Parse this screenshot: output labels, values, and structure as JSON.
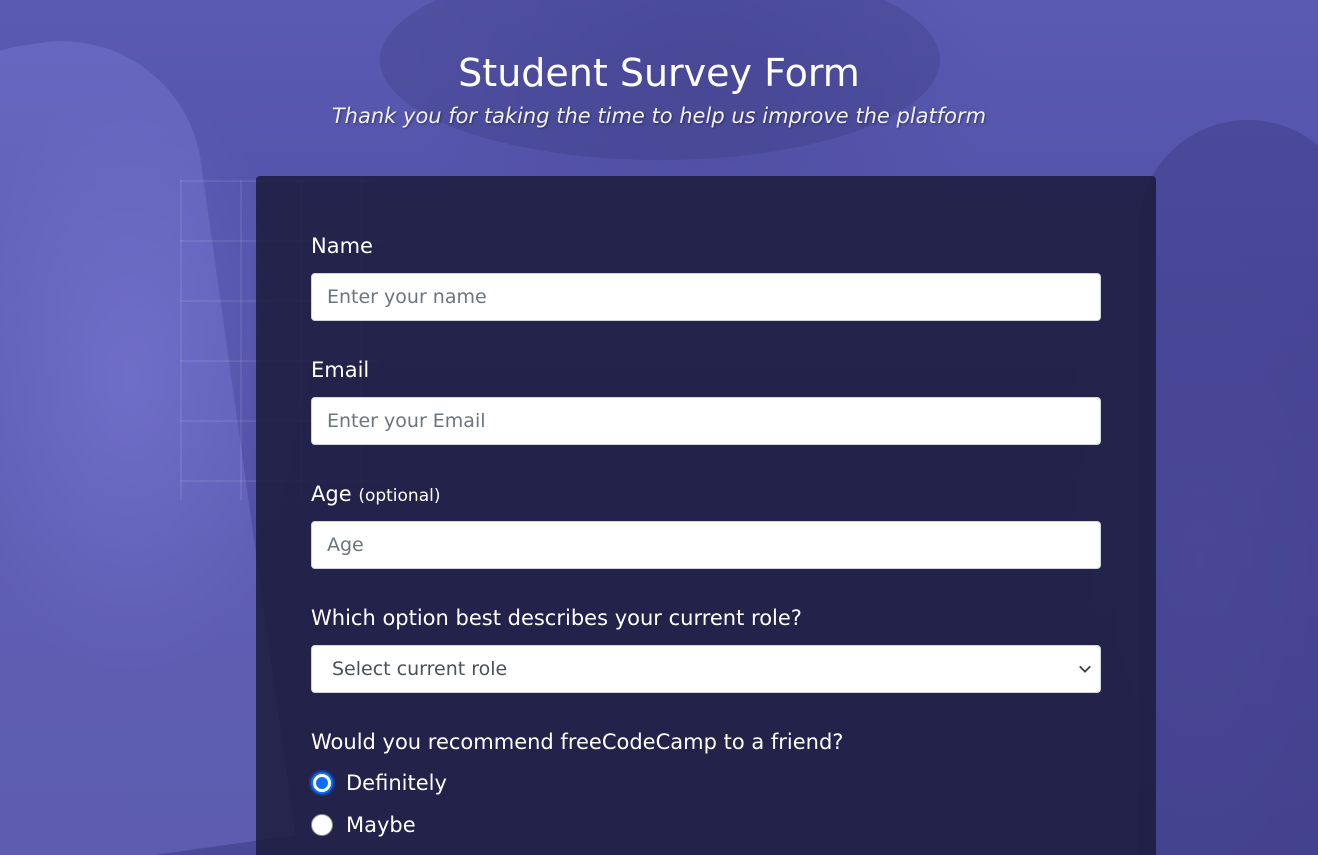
{
  "header": {
    "title": "Student Survey Form",
    "description": "Thank you for taking the time to help us improve the platform"
  },
  "form": {
    "name": {
      "label": "Name",
      "placeholder": "Enter your name",
      "value": ""
    },
    "email": {
      "label": "Email",
      "placeholder": "Enter your Email",
      "value": ""
    },
    "age": {
      "label": "Age",
      "clue": "(optional)",
      "placeholder": "Age",
      "value": ""
    },
    "role": {
      "label": "Which option best describes your current role?",
      "selected": "Select current role"
    },
    "recommend": {
      "label": "Would you recommend freeCodeCamp to a friend?",
      "options": [
        {
          "label": "Definitely",
          "checked": true
        },
        {
          "label": "Maybe",
          "checked": false
        }
      ]
    }
  },
  "colors": {
    "accent": "#0d6efd",
    "card_background": "#1b1b3c",
    "page_overlay": "#5554a8"
  }
}
